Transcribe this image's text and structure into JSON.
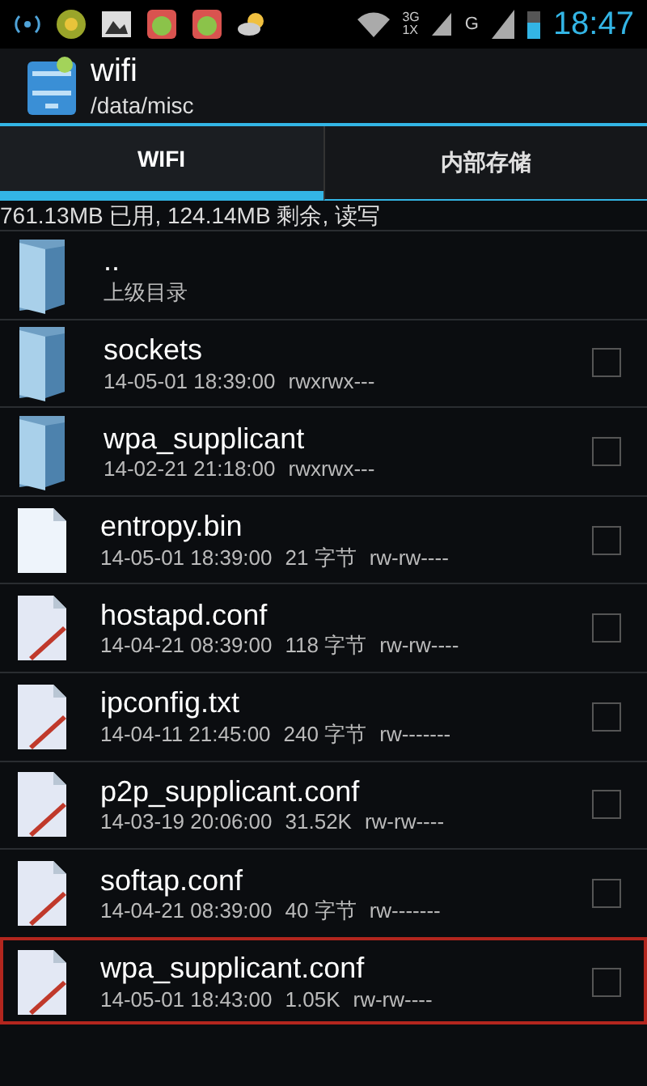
{
  "status_bar": {
    "network_labels": [
      "3G",
      "1X"
    ],
    "signal_label": "G",
    "time": "18:47"
  },
  "action_bar": {
    "title": "wifi",
    "subtitle": "/data/misc"
  },
  "tabs": [
    {
      "label": "WIFI",
      "selected": true
    },
    {
      "label": "内部存储",
      "selected": false
    }
  ],
  "storage_info": "761.13MB 已用, 124.14MB 剩余, 读写",
  "files": [
    {
      "kind": "folder",
      "name": "..",
      "details": [
        "上级目录"
      ],
      "highlighted": false
    },
    {
      "kind": "folder",
      "name": "sockets",
      "details": [
        "14-05-01 18:39:00",
        "rwxrwx---"
      ],
      "checked": false,
      "highlighted": false
    },
    {
      "kind": "folder",
      "name": "wpa_supplicant",
      "details": [
        "14-02-21 21:18:00",
        "rwxrwx---"
      ],
      "checked": false,
      "highlighted": false
    },
    {
      "kind": "file",
      "name": "entropy.bin",
      "details": [
        "14-05-01 18:39:00",
        "21 字节",
        "rw-rw----"
      ],
      "checked": false,
      "highlighted": false
    },
    {
      "kind": "text",
      "name": "hostapd.conf",
      "details": [
        "14-04-21 08:39:00",
        "118 字节",
        "rw-rw----"
      ],
      "checked": false,
      "highlighted": false
    },
    {
      "kind": "text",
      "name": "ipconfig.txt",
      "details": [
        "14-04-11 21:45:00",
        "240 字节",
        "rw-------"
      ],
      "checked": false,
      "highlighted": false
    },
    {
      "kind": "text",
      "name": "p2p_supplicant.conf",
      "details": [
        "14-03-19 20:06:00",
        "31.52K",
        "rw-rw----"
      ],
      "checked": false,
      "highlighted": false
    },
    {
      "kind": "text",
      "name": "softap.conf",
      "details": [
        "14-04-21 08:39:00",
        "40 字节",
        "rw-------"
      ],
      "checked": false,
      "highlighted": false
    },
    {
      "kind": "text",
      "name": "wpa_supplicant.conf",
      "details": [
        "14-05-01 18:43:00",
        "1.05K",
        "rw-rw----"
      ],
      "checked": false,
      "highlighted": true
    }
  ]
}
